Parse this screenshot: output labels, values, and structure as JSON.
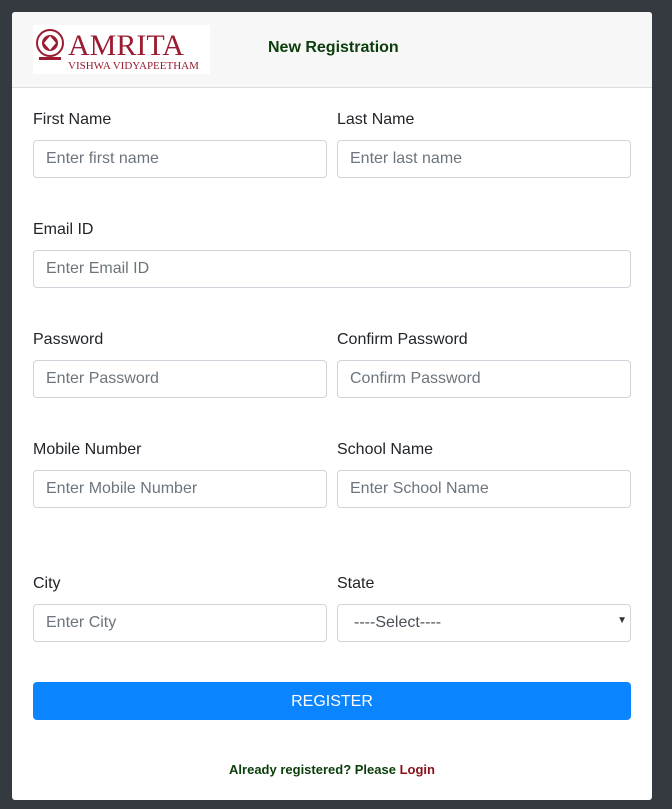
{
  "header": {
    "logo_main": "AMRITA",
    "logo_sub": "VISHWA VIDYAPEETHAM",
    "title": "New Registration"
  },
  "form": {
    "first_name": {
      "label": "First Name",
      "placeholder": "Enter first name"
    },
    "last_name": {
      "label": "Last Name",
      "placeholder": "Enter last name"
    },
    "email": {
      "label": "Email ID",
      "placeholder": "Enter Email ID"
    },
    "password": {
      "label": "Password",
      "placeholder": "Enter Password"
    },
    "confirm_password": {
      "label": "Confirm Password",
      "placeholder": "Confirm Password"
    },
    "mobile": {
      "label": "Mobile Number",
      "placeholder": "Enter Mobile Number"
    },
    "school": {
      "label": "School Name",
      "placeholder": "Enter School Name"
    },
    "city": {
      "label": "City",
      "placeholder": "Enter City"
    },
    "state": {
      "label": "State",
      "selected": "----Select----"
    }
  },
  "register_label": "REGISTER",
  "footer": {
    "prompt": "Already registered? Please",
    "login_label": "Login"
  },
  "colors": {
    "background": "#343a40",
    "primary_button": "#0b84ff",
    "header_title": "#0b3d0b",
    "login_link": "#8a0f1a",
    "logo": "#9b1b30"
  }
}
